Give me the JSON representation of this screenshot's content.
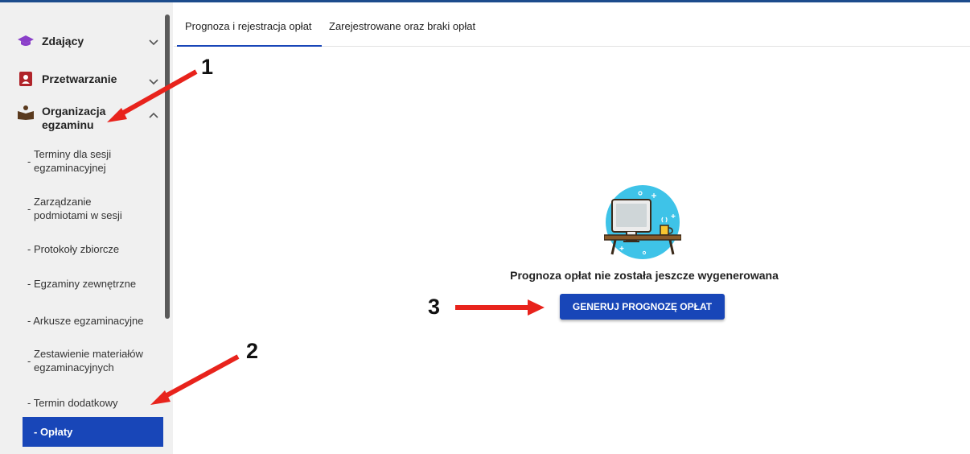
{
  "sidebar": {
    "groups": [
      {
        "label": "Zdający",
        "icon": "graduation-cap-icon"
      },
      {
        "label": "Przetwarzanie",
        "icon": "id-card-icon"
      },
      {
        "label": "Organizacja egzaminu",
        "line1": "Organizacja",
        "line2": "egzaminu",
        "icon": "reading-person-icon"
      }
    ],
    "items": [
      {
        "line1": "Terminy dla sesji",
        "line2": "egzaminacyjnej"
      },
      {
        "line1": "Zarządzanie",
        "line2": "podmiotami w sesji"
      },
      {
        "line1": "- Protokoły zbiorcze"
      },
      {
        "line1": "- Egzaminy zewnętrzne"
      },
      {
        "line1": "- Arkusze egzaminacyjne"
      },
      {
        "line1": "Zestawienie materiałów",
        "line2": "egzaminacyjnych"
      },
      {
        "line1": "- Termin dodatkowy"
      },
      {
        "line1": "- Opłaty",
        "active": true
      }
    ]
  },
  "tabs": [
    {
      "label": "Prognoza i rejestracja opłat",
      "active": true
    },
    {
      "label": "Zarejestrowane oraz braki opłat",
      "active": false
    }
  ],
  "main": {
    "empty_message": "Prognoza opłat nie została jeszcze wygenerowana",
    "generate_button": "GENERUJ PROGNOZĘ OPŁAT",
    "illustration": "computer-desk-coffee-icon"
  },
  "annotations": [
    "1",
    "2",
    "3"
  ],
  "colors": {
    "accent": "#1846b8",
    "arrow": "#e8231c",
    "cap_icon": "#8a3fc9",
    "book_icon": "#b0242a",
    "person_icon": "#5a3a1e"
  }
}
